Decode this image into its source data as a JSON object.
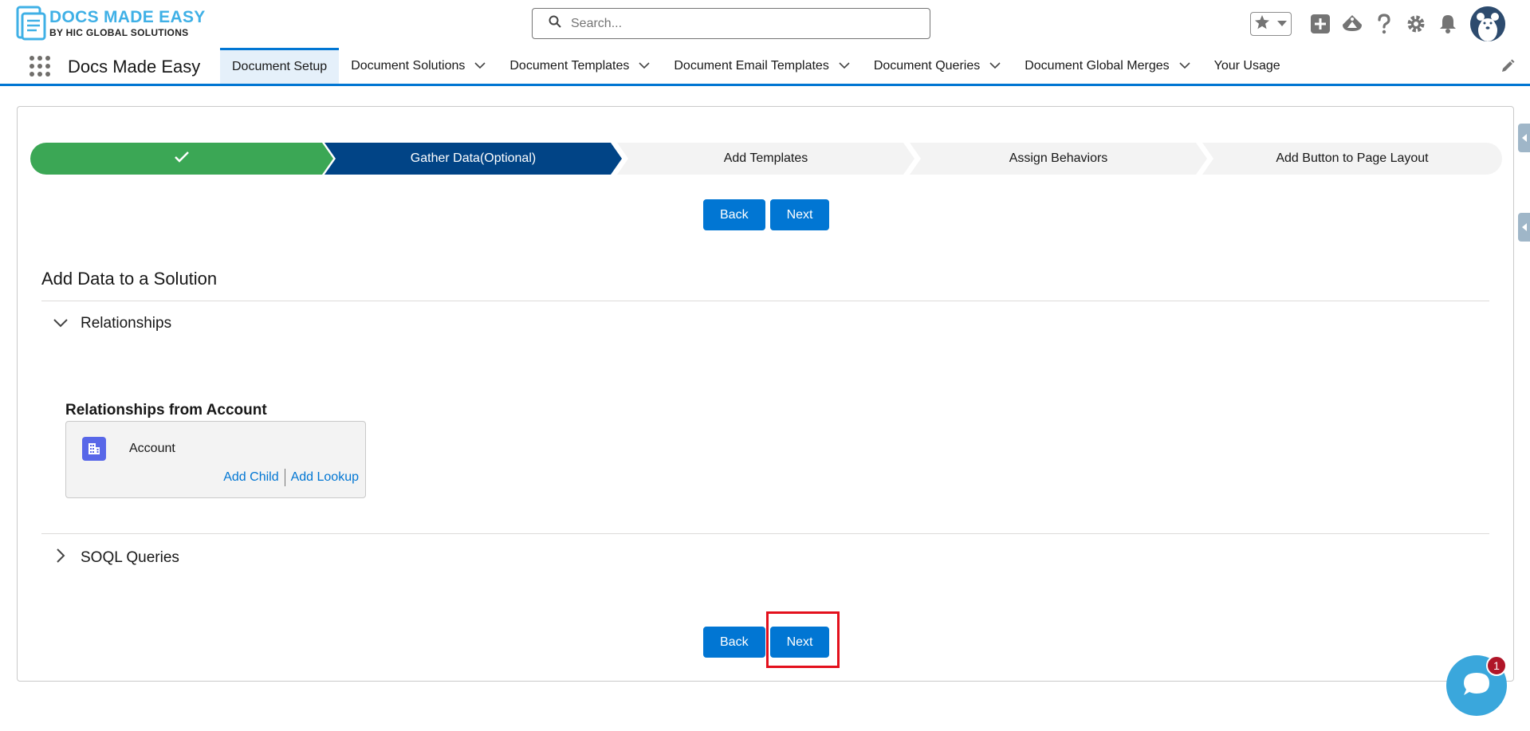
{
  "header": {
    "logo": {
      "title": "DOCS MADE EASY",
      "subtitle": "BY HIC GLOBAL SOLUTIONS"
    },
    "search": {
      "placeholder": "Search..."
    },
    "icons": [
      "star-icon",
      "chevron-down-icon",
      "plus-icon",
      "trailhead-icon",
      "help-icon",
      "gear-icon",
      "bell-icon",
      "avatar"
    ]
  },
  "nav": {
    "app_name": "Docs Made Easy",
    "items": [
      {
        "label": "Document Setup",
        "active": true,
        "dropdown": false
      },
      {
        "label": "Document Solutions",
        "dropdown": true
      },
      {
        "label": "Document Templates",
        "dropdown": true
      },
      {
        "label": "Document Email Templates",
        "dropdown": true
      },
      {
        "label": "Document Queries",
        "dropdown": true
      },
      {
        "label": "Document Global Merges",
        "dropdown": true
      },
      {
        "label": "Your Usage",
        "dropdown": false
      }
    ]
  },
  "path": {
    "steps": [
      {
        "label": "",
        "state": "complete"
      },
      {
        "label": "Gather Data(Optional)",
        "state": "current"
      },
      {
        "label": "Add Templates",
        "state": "incomplete"
      },
      {
        "label": "Assign Behaviors",
        "state": "incomplete"
      },
      {
        "label": "Add Button to Page Layout",
        "state": "incomplete"
      }
    ]
  },
  "buttons": {
    "back": "Back",
    "next": "Next"
  },
  "main": {
    "title": "Add Data to a Solution",
    "relationships": {
      "label": "Relationships",
      "heading": "Relationships from Account",
      "object_name": "Account",
      "add_child": "Add Child",
      "add_lookup": "Add Lookup"
    },
    "soql": {
      "label": "SOQL Queries"
    }
  },
  "chat": {
    "badge": "1"
  },
  "colors": {
    "brand": "#0176d3",
    "complete": "#3ba755",
    "current": "#014486",
    "incomplete": "#f3f3f3",
    "highlight": "#e3101c"
  }
}
